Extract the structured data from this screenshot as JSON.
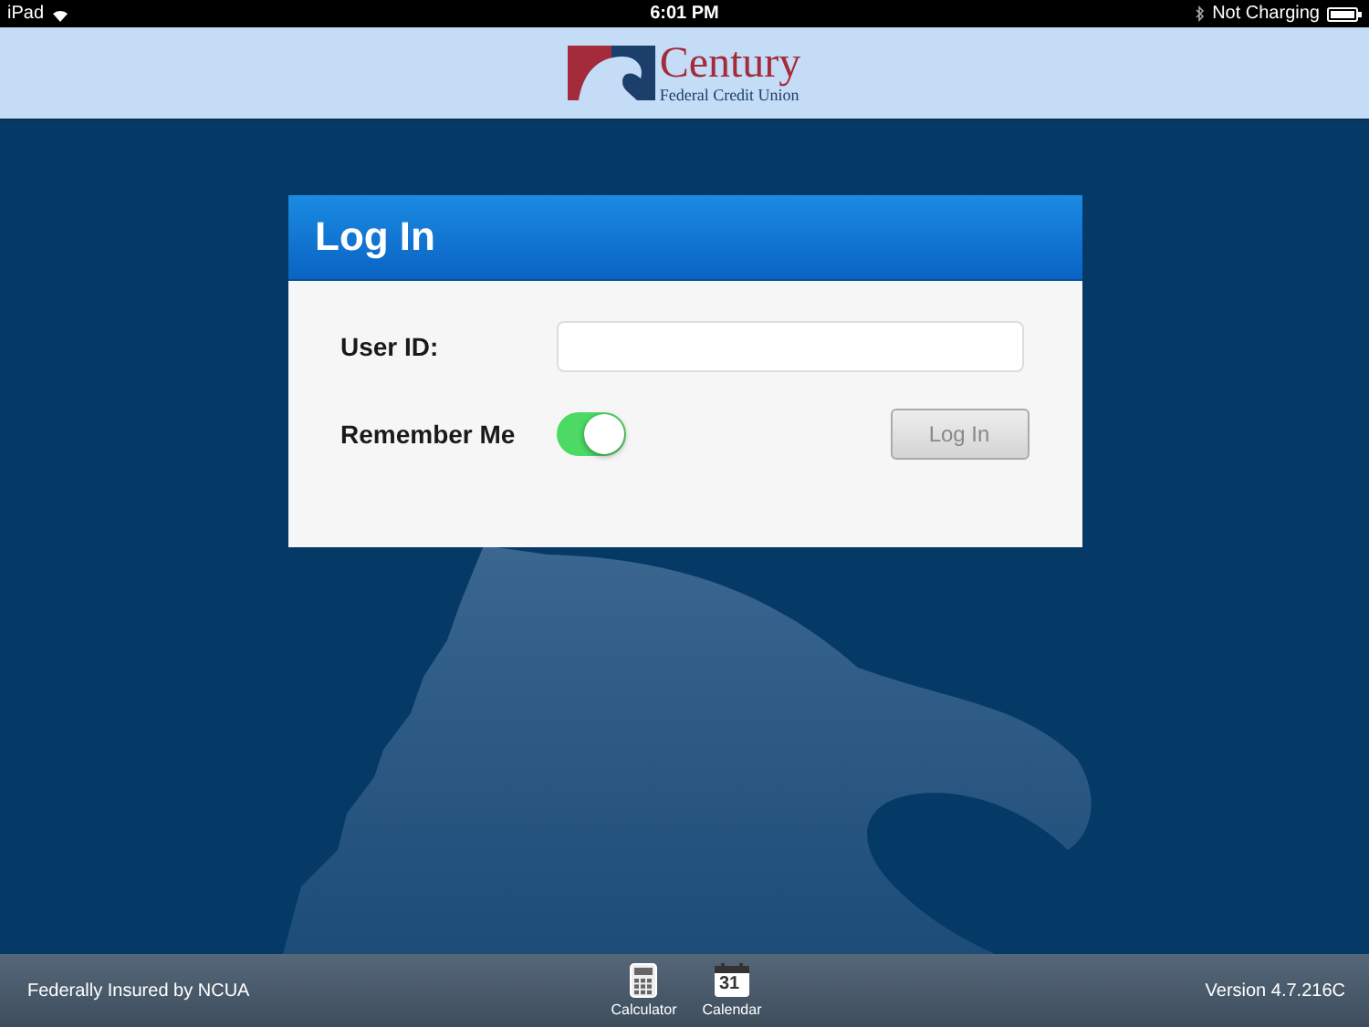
{
  "status_bar": {
    "device": "iPad",
    "time": "6:01 PM",
    "charging": "Not Charging"
  },
  "header": {
    "logo_name": "Century",
    "logo_subtitle": "Federal Credit Union"
  },
  "login": {
    "title": "Log In",
    "user_id": {
      "label": "User ID:"
    },
    "remember": {
      "label": "Remember Me",
      "on": true
    },
    "button": {
      "label": "Log In",
      "disabled": true
    }
  },
  "footer": {
    "left": "Federally Insured by NCUA",
    "tools": [
      {
        "kind": "calculator",
        "label": "Calculator"
      },
      {
        "kind": "calendar",
        "label": "Calendar",
        "day": "31"
      }
    ],
    "version": "Version 4.7.216C"
  }
}
